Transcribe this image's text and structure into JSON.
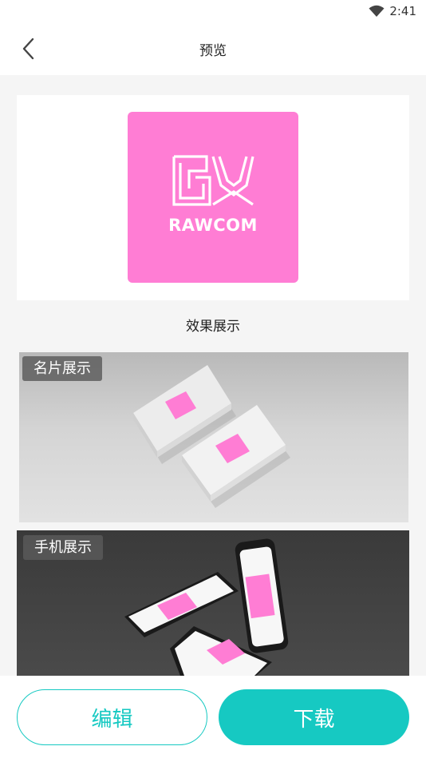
{
  "status_bar": {
    "time": "2:41",
    "wifi_icon": "wifi-icon"
  },
  "header": {
    "title": "预览",
    "back_icon": "chevron-left-icon"
  },
  "logo": {
    "brand_text": "RAWCOM",
    "tile_color": "#ff7dd4",
    "mark_icon": "rawcom-logo-mark"
  },
  "effects_label": "效果展示",
  "mockups": [
    {
      "tag": "名片展示"
    },
    {
      "tag": "手机展示"
    }
  ],
  "actions": {
    "edit_label": "编辑",
    "download_label": "下载",
    "accent_color": "#16c9c2"
  }
}
